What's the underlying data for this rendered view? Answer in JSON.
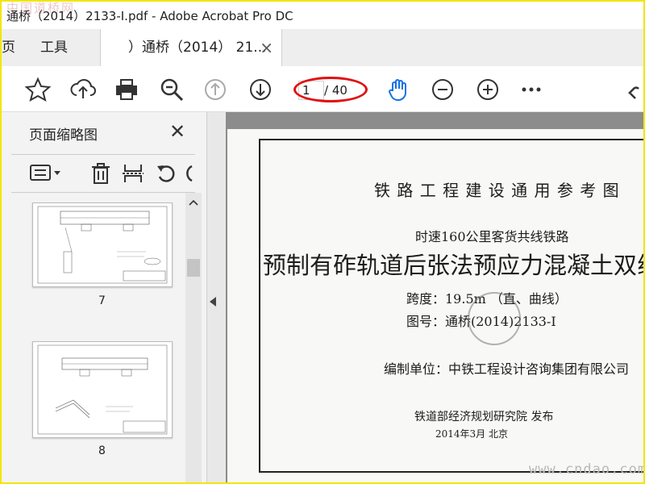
{
  "window": {
    "title": "通桥（2014）2133-I.pdf - Adobe Acrobat Pro DC",
    "watermark_top": "中国道桥网",
    "watermark_bottom": "www.cndao.com"
  },
  "tabs": {
    "home_partial": "页",
    "tools": "工具",
    "document": "）通桥（2014） 21...",
    "close": "×"
  },
  "toolbar": {
    "page_current": "1",
    "page_total": "/ 40",
    "icons": [
      "star-icon",
      "upload-icon",
      "print-icon",
      "zoom-out-search-icon",
      "page-up-icon",
      "page-down-icon",
      "hand-tool-icon",
      "zoom-out-icon",
      "zoom-in-icon",
      "more-icon",
      "link-icon"
    ]
  },
  "sidebar": {
    "title": "页面缩略图",
    "close": "✕",
    "thumbnails": [
      {
        "number": "7"
      },
      {
        "number": "8"
      }
    ]
  },
  "document": {
    "line1": "铁 路 工 程 建 设 通 用 参 考 图",
    "line2": "时速160公里客货共线铁路",
    "line3": "预制有砟轨道后张法预应力混凝土双线并置简",
    "line4": "跨度：19.5m （直、曲线）",
    "line5": "图号：通桥(2014)2133-Ⅰ",
    "line6": "编制单位：中铁工程设计咨询集团有限公司",
    "line7": "铁道部经济规划研究院  发布",
    "line8": "2014年3月     北京"
  },
  "colors": {
    "highlight_ring": "#e01010",
    "hand_tool": "#1473e6",
    "frame": "#f2e600"
  }
}
